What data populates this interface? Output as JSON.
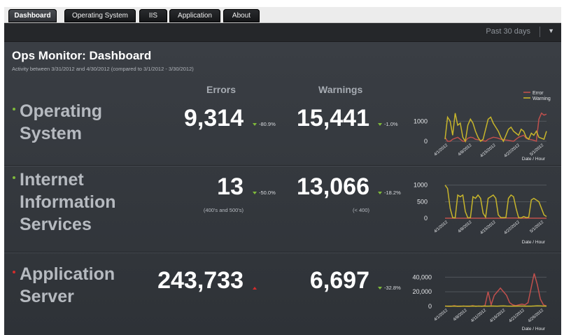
{
  "tabs": [
    {
      "label": "Dashboard",
      "active": true
    },
    {
      "label": "Operating System",
      "active": false
    },
    {
      "label": "IIS",
      "active": false
    },
    {
      "label": "Application",
      "active": false
    },
    {
      "label": "About",
      "active": false
    }
  ],
  "toolbar": {
    "range_label": "Past 30 days"
  },
  "header": {
    "title": "Ops Monitor: Dashboard",
    "subtitle": "Activity between 3/31/2012 and 4/30/2012 (compared to 3/1/2012 - 3/30/2012)"
  },
  "columns": {
    "errors": "Errors",
    "warnings": "Warnings"
  },
  "colors": {
    "error_line": "#c0504d",
    "warning_line": "#c7b52b",
    "down_arrow": "#7fba3a",
    "up_arrow": "#d22c2c",
    "status_ok": "#7fba3a",
    "status_bad": "#d22c2c"
  },
  "rows": [
    {
      "name_lines": [
        "Operating",
        "System"
      ],
      "status": "ok",
      "errors": "9,314",
      "errors_change": "-80.9%",
      "errors_change_dir": "down",
      "errors_note": "",
      "warnings": "15,441",
      "warnings_change": "-1.0%",
      "warnings_change_dir": "down",
      "warnings_note": ""
    },
    {
      "name_lines": [
        "Internet",
        "Information",
        "Services"
      ],
      "status": "ok",
      "errors": "13",
      "errors_change": "-50.0%",
      "errors_change_dir": "down",
      "errors_note": "(400's and 500's)",
      "warnings": "13,066",
      "warnings_change": "-18.2%",
      "warnings_change_dir": "down",
      "warnings_note": "(< 400)"
    },
    {
      "name_lines": [
        "Application",
        "Server"
      ],
      "status": "bad",
      "errors": "243,733",
      "errors_change": "",
      "errors_change_dir": "up",
      "errors_note": "",
      "warnings": "6,697",
      "warnings_change": "-32.8%",
      "warnings_change_dir": "down",
      "warnings_note": ""
    }
  ],
  "chart_data": [
    {
      "type": "line",
      "xlabel": "Date / Hour",
      "legend": [
        "Error",
        "Warning"
      ],
      "legend_position": "top-right",
      "yticks": [
        "1000",
        "0"
      ],
      "ylim": [
        0,
        1600
      ],
      "xticks": [
        "4/1/2012",
        "4/8/2012",
        "4/15/2012",
        "4/22/2012",
        "5/1/2012"
      ],
      "grid": true,
      "series": [
        {
          "name": "Error",
          "values": [
            200,
            0,
            0,
            100,
            150,
            200,
            100,
            0,
            0,
            150,
            200,
            180,
            100,
            80,
            50,
            30,
            0,
            100,
            150,
            200,
            180,
            150,
            100,
            80,
            60,
            50,
            20,
            0,
            100,
            200,
            250,
            300,
            150,
            100,
            80,
            50,
            0,
            1100,
            1400,
            1300,
            1350
          ]
        },
        {
          "name": "Warning",
          "values": [
            100,
            1200,
            1000,
            300,
            1400,
            800,
            900,
            200,
            0,
            800,
            1100,
            900,
            500,
            200,
            0,
            100,
            600,
            1100,
            1200,
            900,
            700,
            500,
            200,
            0,
            300,
            600,
            700,
            500,
            400,
            300,
            600,
            500,
            200,
            100,
            400,
            300,
            500,
            200,
            150,
            100,
            500
          ]
        }
      ]
    },
    {
      "type": "line",
      "xlabel": "Date / Hour",
      "yticks": [
        "1000",
        "500",
        "0"
      ],
      "ylim": [
        0,
        1100
      ],
      "xticks": [
        "4/1/2012",
        "4/8/2012",
        "4/15/2012",
        "4/22/2012",
        "5/1/2012"
      ],
      "grid": true,
      "series": [
        {
          "name": "Error",
          "values": [
            0,
            0,
            0,
            0,
            0,
            0,
            0,
            0,
            0,
            0,
            0,
            0,
            0,
            0,
            0,
            0,
            0,
            0,
            0,
            0,
            0,
            0,
            0,
            0,
            5,
            5,
            5,
            5,
            5,
            0,
            0,
            0,
            0,
            0,
            0,
            0,
            0,
            0,
            0,
            0,
            0
          ]
        },
        {
          "name": "Warning",
          "values": [
            1000,
            900,
            300,
            20,
            10,
            700,
            650,
            700,
            200,
            10,
            20,
            650,
            600,
            700,
            600,
            150,
            30,
            600,
            650,
            700,
            600,
            100,
            20,
            20,
            20,
            600,
            700,
            650,
            300,
            20,
            10,
            50,
            20,
            30,
            550,
            600,
            550,
            500,
            300,
            100,
            50
          ]
        }
      ]
    },
    {
      "type": "line",
      "xlabel": "Date / Hour",
      "yticks": [
        "40,000",
        "20,000",
        "0"
      ],
      "ylim": [
        0,
        46000
      ],
      "xticks": [
        "4/1/2012",
        "4/8/2012",
        "4/11/2012",
        "4/16/2012",
        "4/21/2012",
        "4/26/2012"
      ],
      "grid": true,
      "series": [
        {
          "name": "Error",
          "values": [
            500,
            0,
            0,
            1000,
            0,
            0,
            500,
            0,
            0,
            1000,
            0,
            500,
            0,
            1000,
            20000,
            2000,
            15000,
            20000,
            25000,
            20000,
            15000,
            5000,
            2000,
            1000,
            2000,
            3000,
            2000,
            5000,
            25000,
            45000,
            30000,
            10000,
            2000,
            500
          ]
        },
        {
          "name": "Warning",
          "values": [
            300,
            200,
            300,
            200,
            100,
            300,
            200,
            300,
            200,
            400,
            300,
            200,
            300,
            400,
            300,
            500,
            400,
            300,
            500,
            600,
            400,
            300,
            200,
            300,
            400,
            500,
            300,
            200,
            300,
            500,
            800,
            600,
            400,
            300
          ]
        }
      ]
    }
  ]
}
